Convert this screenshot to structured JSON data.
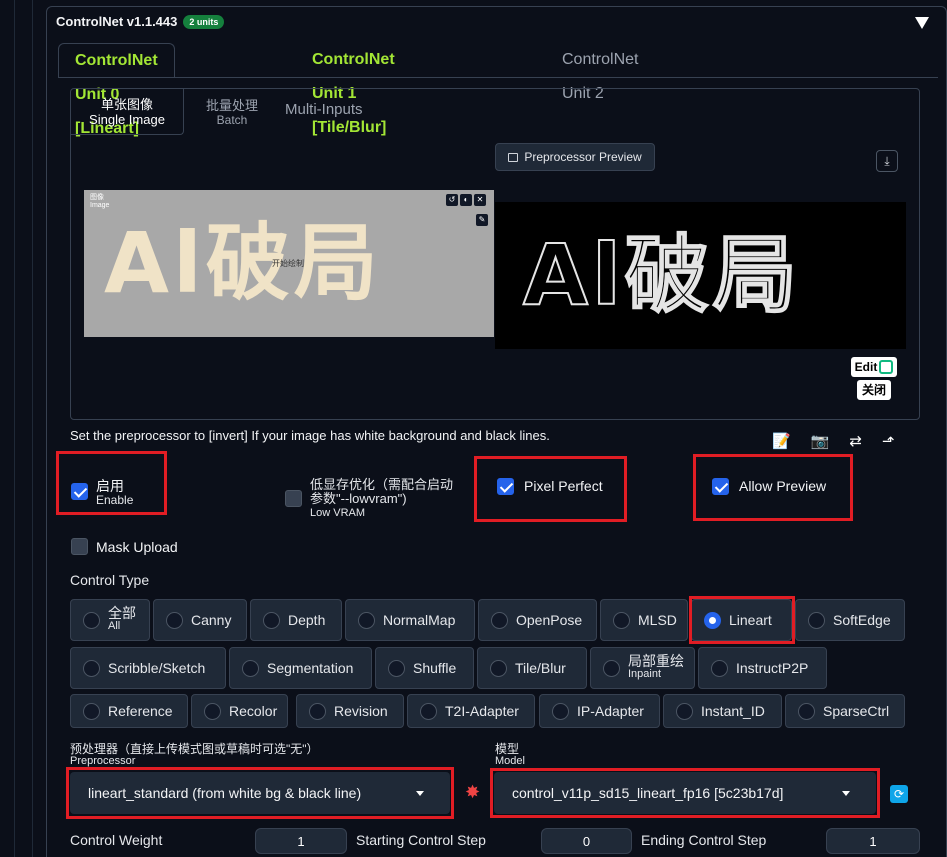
{
  "header": {
    "title": "ControlNet v1.1.443",
    "badge": "2 units"
  },
  "unit_tabs": [
    {
      "label": "ControlNet Unit 0 [Lineart]"
    },
    {
      "label": "ControlNet Unit 1 [Tile/Blur]"
    },
    {
      "label": "ControlNet Unit 2"
    }
  ],
  "image_tabs": [
    {
      "label_cn": "单张图像",
      "label_en": "Single Image"
    },
    {
      "label_cn": "批量处理",
      "label_en": "Batch"
    },
    {
      "label": "Multi-Inputs"
    }
  ],
  "input_image": {
    "label_cn": "图像",
    "label_en": "Image",
    "text_big": "Al破局",
    "text_small": "开始绘制"
  },
  "preview": {
    "button": "Preprocessor Preview",
    "text_big": "Al破局",
    "edit": "Edit",
    "close": "关闭"
  },
  "hint": "Set the preprocessor to [invert] If your image has white background and black lines.",
  "toolbar_icons": [
    "memo-icon",
    "camera-icon",
    "swap-icon",
    "arrow-up-icon"
  ],
  "options": {
    "enable": {
      "cn": "启用",
      "en": "Enable",
      "checked": true
    },
    "low_vram": {
      "cn1": "低显存优化（需配合启动",
      "cn2": "参数\"--lowvram\")",
      "en": "Low VRAM",
      "checked": false
    },
    "pixel_perfect": {
      "label": "Pixel Perfect",
      "checked": true
    },
    "allow_preview": {
      "label": "Allow Preview",
      "checked": true
    },
    "mask_upload": {
      "label": "Mask Upload",
      "checked": false
    }
  },
  "control_type": {
    "label": "Control Type",
    "selected": "Lineart",
    "rows": [
      [
        {
          "cn": "全部",
          "en": "All"
        },
        {
          "label": "Canny"
        },
        {
          "label": "Depth"
        },
        {
          "label": "NormalMap"
        },
        {
          "label": "OpenPose"
        },
        {
          "label": "MLSD"
        },
        {
          "label": "Lineart"
        },
        {
          "label": "SoftEdge"
        }
      ],
      [
        {
          "label": "Scribble/Sketch"
        },
        {
          "label": "Segmentation"
        },
        {
          "label": "Shuffle"
        },
        {
          "label": "Tile/Blur"
        },
        {
          "cn": "局部重绘",
          "en": "Inpaint"
        },
        {
          "label": "InstructP2P"
        }
      ],
      [
        {
          "label": "Reference"
        },
        {
          "label": "Recolor"
        },
        {
          "label": "Revision"
        },
        {
          "label": "T2I-Adapter"
        },
        {
          "label": "IP-Adapter"
        },
        {
          "label": "Instant_ID"
        },
        {
          "label": "SparseCtrl"
        }
      ]
    ]
  },
  "preprocessor": {
    "label_cn": "预处理器（直接上传模式图或草稿时可选\"无\"）",
    "label_en": "Preprocessor",
    "value": "lineart_standard (from white bg & black line)"
  },
  "model": {
    "label_cn": "模型",
    "label_en": "Model",
    "value": "control_v11p_sd15_lineart_fp16 [5c23b17d]"
  },
  "sliders": {
    "weight": {
      "label": "Control Weight",
      "value": "1"
    },
    "start": {
      "label": "Starting Control Step",
      "value": "0"
    },
    "end": {
      "label": "Ending Control Step",
      "value": "1"
    }
  },
  "colors": {
    "accent": "#2563eb",
    "tab_active": "#a3e635",
    "highlight": "#e11d24",
    "background": "#0b0f19"
  }
}
